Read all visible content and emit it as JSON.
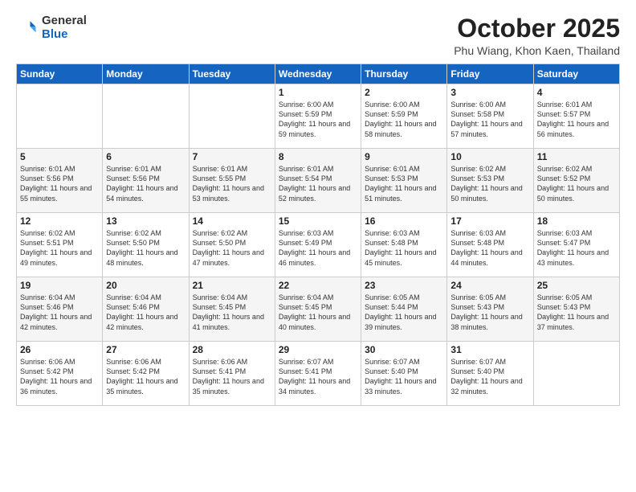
{
  "logo": {
    "general": "General",
    "blue": "Blue"
  },
  "header": {
    "month": "October 2025",
    "location": "Phu Wiang, Khon Kaen, Thailand"
  },
  "weekdays": [
    "Sunday",
    "Monday",
    "Tuesday",
    "Wednesday",
    "Thursday",
    "Friday",
    "Saturday"
  ],
  "weeks": [
    [
      {
        "day": "",
        "sunrise": "",
        "sunset": "",
        "daylight": ""
      },
      {
        "day": "",
        "sunrise": "",
        "sunset": "",
        "daylight": ""
      },
      {
        "day": "",
        "sunrise": "",
        "sunset": "",
        "daylight": ""
      },
      {
        "day": "1",
        "sunrise": "Sunrise: 6:00 AM",
        "sunset": "Sunset: 5:59 PM",
        "daylight": "Daylight: 11 hours and 59 minutes."
      },
      {
        "day": "2",
        "sunrise": "Sunrise: 6:00 AM",
        "sunset": "Sunset: 5:59 PM",
        "daylight": "Daylight: 11 hours and 58 minutes."
      },
      {
        "day": "3",
        "sunrise": "Sunrise: 6:00 AM",
        "sunset": "Sunset: 5:58 PM",
        "daylight": "Daylight: 11 hours and 57 minutes."
      },
      {
        "day": "4",
        "sunrise": "Sunrise: 6:01 AM",
        "sunset": "Sunset: 5:57 PM",
        "daylight": "Daylight: 11 hours and 56 minutes."
      }
    ],
    [
      {
        "day": "5",
        "sunrise": "Sunrise: 6:01 AM",
        "sunset": "Sunset: 5:56 PM",
        "daylight": "Daylight: 11 hours and 55 minutes."
      },
      {
        "day": "6",
        "sunrise": "Sunrise: 6:01 AM",
        "sunset": "Sunset: 5:56 PM",
        "daylight": "Daylight: 11 hours and 54 minutes."
      },
      {
        "day": "7",
        "sunrise": "Sunrise: 6:01 AM",
        "sunset": "Sunset: 5:55 PM",
        "daylight": "Daylight: 11 hours and 53 minutes."
      },
      {
        "day": "8",
        "sunrise": "Sunrise: 6:01 AM",
        "sunset": "Sunset: 5:54 PM",
        "daylight": "Daylight: 11 hours and 52 minutes."
      },
      {
        "day": "9",
        "sunrise": "Sunrise: 6:01 AM",
        "sunset": "Sunset: 5:53 PM",
        "daylight": "Daylight: 11 hours and 51 minutes."
      },
      {
        "day": "10",
        "sunrise": "Sunrise: 6:02 AM",
        "sunset": "Sunset: 5:53 PM",
        "daylight": "Daylight: 11 hours and 50 minutes."
      },
      {
        "day": "11",
        "sunrise": "Sunrise: 6:02 AM",
        "sunset": "Sunset: 5:52 PM",
        "daylight": "Daylight: 11 hours and 50 minutes."
      }
    ],
    [
      {
        "day": "12",
        "sunrise": "Sunrise: 6:02 AM",
        "sunset": "Sunset: 5:51 PM",
        "daylight": "Daylight: 11 hours and 49 minutes."
      },
      {
        "day": "13",
        "sunrise": "Sunrise: 6:02 AM",
        "sunset": "Sunset: 5:50 PM",
        "daylight": "Daylight: 11 hours and 48 minutes."
      },
      {
        "day": "14",
        "sunrise": "Sunrise: 6:02 AM",
        "sunset": "Sunset: 5:50 PM",
        "daylight": "Daylight: 11 hours and 47 minutes."
      },
      {
        "day": "15",
        "sunrise": "Sunrise: 6:03 AM",
        "sunset": "Sunset: 5:49 PM",
        "daylight": "Daylight: 11 hours and 46 minutes."
      },
      {
        "day": "16",
        "sunrise": "Sunrise: 6:03 AM",
        "sunset": "Sunset: 5:48 PM",
        "daylight": "Daylight: 11 hours and 45 minutes."
      },
      {
        "day": "17",
        "sunrise": "Sunrise: 6:03 AM",
        "sunset": "Sunset: 5:48 PM",
        "daylight": "Daylight: 11 hours and 44 minutes."
      },
      {
        "day": "18",
        "sunrise": "Sunrise: 6:03 AM",
        "sunset": "Sunset: 5:47 PM",
        "daylight": "Daylight: 11 hours and 43 minutes."
      }
    ],
    [
      {
        "day": "19",
        "sunrise": "Sunrise: 6:04 AM",
        "sunset": "Sunset: 5:46 PM",
        "daylight": "Daylight: 11 hours and 42 minutes."
      },
      {
        "day": "20",
        "sunrise": "Sunrise: 6:04 AM",
        "sunset": "Sunset: 5:46 PM",
        "daylight": "Daylight: 11 hours and 42 minutes."
      },
      {
        "day": "21",
        "sunrise": "Sunrise: 6:04 AM",
        "sunset": "Sunset: 5:45 PM",
        "daylight": "Daylight: 11 hours and 41 minutes."
      },
      {
        "day": "22",
        "sunrise": "Sunrise: 6:04 AM",
        "sunset": "Sunset: 5:45 PM",
        "daylight": "Daylight: 11 hours and 40 minutes."
      },
      {
        "day": "23",
        "sunrise": "Sunrise: 6:05 AM",
        "sunset": "Sunset: 5:44 PM",
        "daylight": "Daylight: 11 hours and 39 minutes."
      },
      {
        "day": "24",
        "sunrise": "Sunrise: 6:05 AM",
        "sunset": "Sunset: 5:43 PM",
        "daylight": "Daylight: 11 hours and 38 minutes."
      },
      {
        "day": "25",
        "sunrise": "Sunrise: 6:05 AM",
        "sunset": "Sunset: 5:43 PM",
        "daylight": "Daylight: 11 hours and 37 minutes."
      }
    ],
    [
      {
        "day": "26",
        "sunrise": "Sunrise: 6:06 AM",
        "sunset": "Sunset: 5:42 PM",
        "daylight": "Daylight: 11 hours and 36 minutes."
      },
      {
        "day": "27",
        "sunrise": "Sunrise: 6:06 AM",
        "sunset": "Sunset: 5:42 PM",
        "daylight": "Daylight: 11 hours and 35 minutes."
      },
      {
        "day": "28",
        "sunrise": "Sunrise: 6:06 AM",
        "sunset": "Sunset: 5:41 PM",
        "daylight": "Daylight: 11 hours and 35 minutes."
      },
      {
        "day": "29",
        "sunrise": "Sunrise: 6:07 AM",
        "sunset": "Sunset: 5:41 PM",
        "daylight": "Daylight: 11 hours and 34 minutes."
      },
      {
        "day": "30",
        "sunrise": "Sunrise: 6:07 AM",
        "sunset": "Sunset: 5:40 PM",
        "daylight": "Daylight: 11 hours and 33 minutes."
      },
      {
        "day": "31",
        "sunrise": "Sunrise: 6:07 AM",
        "sunset": "Sunset: 5:40 PM",
        "daylight": "Daylight: 11 hours and 32 minutes."
      },
      {
        "day": "",
        "sunrise": "",
        "sunset": "",
        "daylight": ""
      }
    ]
  ]
}
